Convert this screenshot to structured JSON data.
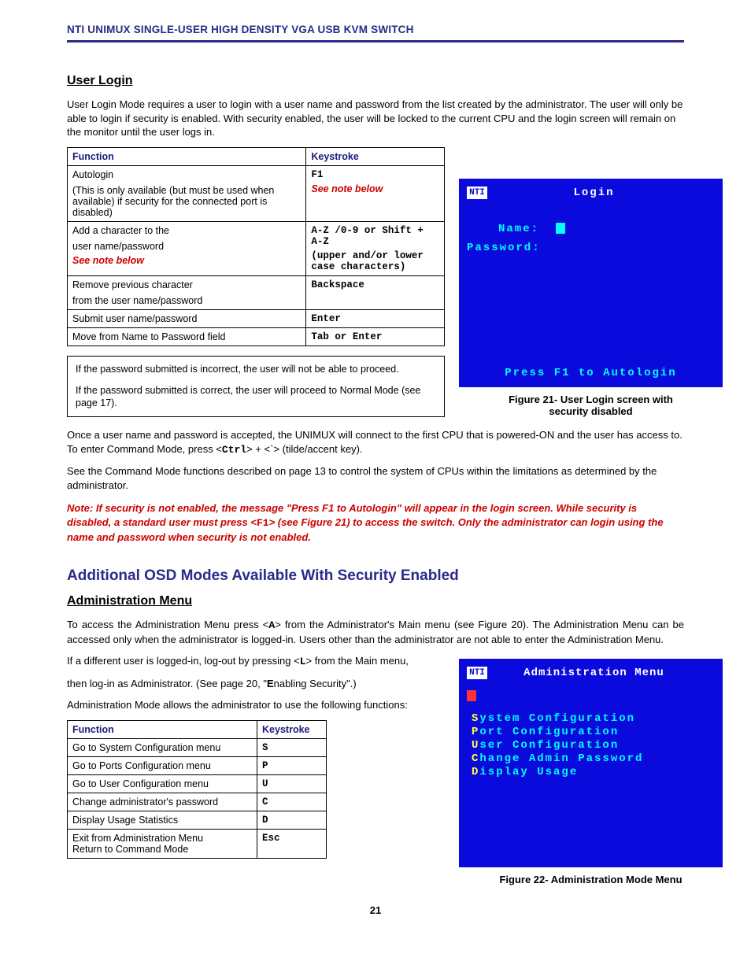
{
  "header": {
    "running": "NTI UNIMUX SINGLE-USER HIGH DENSITY VGA USB KVM SWITCH"
  },
  "user_login": {
    "title": "User Login",
    "intro": "User Login Mode requires a user to login with a user name and password from the list created by the administrator.  The user will only be able to login if security is enabled.      With security enabled, the user will be locked to the current CPU and the login screen will remain on the monitor until the user logs in.",
    "table_headers": {
      "c1": "Function",
      "c2": "Keystroke"
    },
    "rows": [
      {
        "fn_main": "Autologin",
        "fn_sub": "(This is only available (but must be used when available)  if security for the connected port is disabled)",
        "key_main": "F1",
        "key_note": "See note below"
      },
      {
        "fn_main": "Add a character to the",
        "fn_sub2": "user name/password",
        "fn_note": "See note below",
        "key_main": "A-Z /0-9 or  Shift + A-Z",
        "key_sub": "(upper and/or lower case characters)"
      },
      {
        "fn_main": "Remove previous character",
        "fn_sub2": "from the user name/password",
        "key_main": "Backspace"
      },
      {
        "fn_main": "Submit user name/password",
        "key_main": "Enter"
      },
      {
        "fn_main": "Move from Name to Password field",
        "key_main": "Tab or Enter"
      }
    ],
    "notebox_p1": "If the password submitted is incorrect, the user will not be able to proceed.",
    "notebox_p2": "If the password submitted is correct, the user will proceed to Normal Mode (see page 17).",
    "fig21_caption_l1": "Figure 21- User Login screen with",
    "fig21_caption_l2": "security disabled",
    "osd_login": {
      "title": "Login",
      "name_label": "Name:",
      "pass_label": "Password:",
      "footer": "Press F1 to Autologin"
    },
    "para_after1_a": "Once a user name and password is accepted, the UNIMUX will connect to the first CPU that is powered-ON and the user has access to.    To enter Command Mode, press <",
    "para_after1_ctrl": "Ctrl",
    "para_after1_b": "> + <`> (tilde/accent key).",
    "para_after2": "See the Command Mode functions described on page 13 to control the system of CPUs within the limitations as determined by the administrator.",
    "rednote_a": "Note: If security is not enabled, the message \"Press F1 to Autologin\" will appear in the login screen.  While security is disabled, a standard user must press <",
    "rednote_key": "F1",
    "rednote_b": "> (see Figure 21)  to access the switch.    Only the administrator can login using the name and password when security is not enabled."
  },
  "osd_section_title": "Additional OSD Modes Available With Security Enabled",
  "admin_menu": {
    "title": "Administration Menu",
    "p1_a": "To access the Administration Menu press <",
    "p1_key": "A",
    "p1_b": "> from the Administrator's Main menu (see Figure 20). The Administration Menu can be accessed only when the administrator is logged-in. Users other than the administrator are not able to enter the Administration Menu.",
    "p2_a": "If a different user is logged-in, log-out by pressing <",
    "p2_key": "L",
    "p2_b": "> from the Main menu,",
    "p3_a": "then log-in as Administrator.  (See page 20, \"",
    "p3_bold": "E",
    "p3_b": "nabling Security\".)",
    "p4": "Administration Mode allows the administrator to use the following functions:",
    "table_headers": {
      "c1": "Function",
      "c2": "Keystroke"
    },
    "rows": [
      {
        "fn": "Go to System Configuration menu",
        "key": "S"
      },
      {
        "fn": "Go to Ports Configuration menu",
        "key": "P"
      },
      {
        "fn": "Go to User Configuration menu",
        "key": "U"
      },
      {
        "fn": "Change administrator's password",
        "key": "C"
      },
      {
        "fn": "Display Usage Statistics",
        "key": "D"
      },
      {
        "fn": "Exit from Administration Menu\nReturn to Command Mode",
        "key": "Esc"
      }
    ],
    "osd": {
      "title": "Administration Menu",
      "items": [
        {
          "hot": "S",
          "rest": "ystem Configuration"
        },
        {
          "hot": "P",
          "rest": "ort Configuration"
        },
        {
          "hot": "U",
          "rest": "ser Configuration"
        },
        {
          "hot": "C",
          "rest": "hange Admin Password"
        },
        {
          "hot": "D",
          "rest": "isplay Usage"
        }
      ]
    },
    "fig22_caption": "Figure 22- Administration Mode Menu"
  },
  "page_number": "21"
}
